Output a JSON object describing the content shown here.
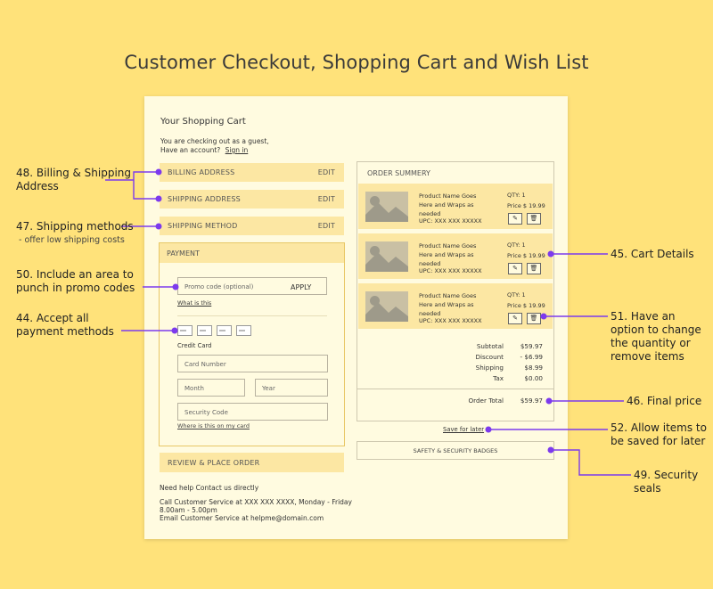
{
  "title": "Customer Checkout, Shopping Cart and Wish List",
  "cart": {
    "heading": "Your Shopping Cart",
    "guest_line": "You are checking out as a guest,",
    "account_line": "Have an account?",
    "sign_in": "Sign in",
    "billing_label": "BILLING ADDRESS",
    "shipping_label": "SHIPPING ADDRESS",
    "shipping_method_label": "SHIPPING METHOD",
    "edit_label": "EDIT",
    "payment": {
      "heading": "PAYMENT",
      "promo_placeholder": "Promo code (optional)",
      "apply": "APPLY",
      "what_is_this": "What is this",
      "credit_card_label": "Credit Card",
      "card_number_placeholder": "Card Number",
      "month_placeholder": "Month",
      "year_placeholder": "Year",
      "security_placeholder": "Security Code",
      "where_is_this": "Where is this on my card"
    },
    "review_label": "REVIEW & PLACE ORDER",
    "help": {
      "heading": "Need help Contact us directly",
      "call_line1": "Call Customer Service at XXX XXX XXXX, Monday - Friday",
      "call_line2": "8.00am - 5.00pm",
      "email_line": "Email Customer Service at helpme@domain.com"
    }
  },
  "order": {
    "heading": "ORDER SUMMERY",
    "items": [
      {
        "name": "Product Name Goes Here and Wraps as needed",
        "upc": "UPC: XXX XXX XXXXX",
        "qty": "QTY: 1",
        "price": "Price $ 19.99"
      },
      {
        "name": "Product Name Goes Here and Wraps as needed",
        "upc": "UPC: XXX XXX XXXXX",
        "qty": "QTY: 1",
        "price": "Price $ 19.99"
      },
      {
        "name": "Product Name Goes Here and Wraps as needed",
        "upc": "UPC: XXX XXX XXXXX",
        "qty": "QTY: 1",
        "price": "Price $ 19.99"
      }
    ],
    "summary": {
      "subtotal_label": "Subtotal",
      "subtotal": "$59.97",
      "discount_label": "Discount",
      "discount": "- $6.99",
      "shipping_label": "Shipping",
      "shipping": "$8.99",
      "tax_label": "Tax",
      "tax": "$0.00",
      "total_label": "Order Total",
      "total": "$59.97"
    },
    "save_for_later": "Save for later",
    "badges": "SAFETY & SECURITY BADGES"
  },
  "annotations": {
    "a48": "48. Billing & Shipping Address",
    "a47": "47. Shipping methods",
    "a47_sub": "- offer low shipping costs",
    "a50": "50. Include an area to punch in promo codes",
    "a44": "44. Accept all payment methods",
    "a45": "45. Cart Details",
    "a51": "51. Have an option to change the quantity or remove items",
    "a46": "46. Final price",
    "a52": "52. Allow items to be saved for later",
    "a49": "49. Security seals"
  },
  "colors": {
    "background": "#FFE27A",
    "sheet": "#FFFBE0",
    "bar": "#FCE7A3",
    "accent": "#7C3AED"
  }
}
